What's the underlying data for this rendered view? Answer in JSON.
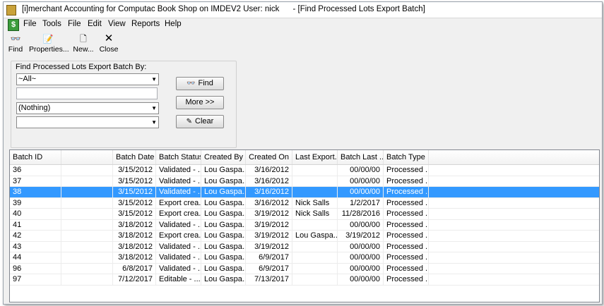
{
  "window": {
    "title": "[i]merchant Accounting for Computac Book Shop on IMDEV2 User: nick      - [Find Processed Lots Export Batch]"
  },
  "menu": [
    "File",
    "Tools",
    "File",
    "Edit",
    "View",
    "Reports",
    "Help"
  ],
  "toolbar": {
    "find": "Find",
    "properties": "Properties...",
    "new": "New...",
    "close": "Close"
  },
  "search": {
    "legend": "Find Processed Lots Export Batch By:",
    "field1_value": "~All~",
    "text_value": "",
    "field2_value": "(Nothing)",
    "field3_value": "",
    "find_button": "Find",
    "more_button": "More >>",
    "clear_button": "Clear"
  },
  "grid": {
    "columns": [
      "Batch ID",
      "",
      "Batch Date",
      "Batch Status",
      "Created By",
      "Created On",
      "Last Export...",
      "Batch Last ...",
      "Batch Type"
    ],
    "selected_row": 2,
    "rows": [
      [
        "36",
        "",
        "3/15/2012",
        "Validated - ...",
        "Lou Gaspa...",
        "3/16/2012",
        "",
        "00/00/00",
        "Processed ..."
      ],
      [
        "37",
        "",
        "3/15/2012",
        "Validated - ...",
        "Lou Gaspa...",
        "3/16/2012",
        "",
        "00/00/00",
        "Processed ..."
      ],
      [
        "38",
        "",
        "3/15/2012",
        "Validated - ...",
        "Lou Gaspa...",
        "3/16/2012",
        "",
        "00/00/00",
        "Processed ..."
      ],
      [
        "39",
        "",
        "3/15/2012",
        "Export crea...",
        "Lou Gaspa...",
        "3/16/2012",
        "Nick Salls",
        "1/2/2017",
        "Processed ..."
      ],
      [
        "40",
        "",
        "3/15/2012",
        "Export crea...",
        "Lou Gaspa...",
        "3/19/2012",
        "Nick Salls",
        "11/28/2016",
        "Processed ..."
      ],
      [
        "41",
        "",
        "3/18/2012",
        "Validated - ...",
        "Lou Gaspa...",
        "3/19/2012",
        "",
        "00/00/00",
        "Processed ..."
      ],
      [
        "42",
        "",
        "3/18/2012",
        "Export crea...",
        "Lou Gaspa...",
        "3/19/2012",
        "Lou Gaspa...",
        "3/19/2012",
        "Processed ..."
      ],
      [
        "43",
        "",
        "3/18/2012",
        "Validated - ...",
        "Lou Gaspa...",
        "3/19/2012",
        "",
        "00/00/00",
        "Processed ..."
      ],
      [
        "44",
        "",
        "3/18/2012",
        "Validated - ...",
        "Lou Gaspa...",
        "6/9/2017",
        "",
        "00/00/00",
        "Processed ..."
      ],
      [
        "96",
        "",
        "6/8/2017",
        "Validated - ...",
        "Lou Gaspa...",
        "6/9/2017",
        "",
        "00/00/00",
        "Processed ..."
      ],
      [
        "97",
        "",
        "7/12/2017",
        "Editable - ...",
        "Lou Gaspa...",
        "7/13/2017",
        "",
        "00/00/00",
        "Processed ..."
      ]
    ]
  },
  "colors": {
    "selection": "#3399ff"
  }
}
